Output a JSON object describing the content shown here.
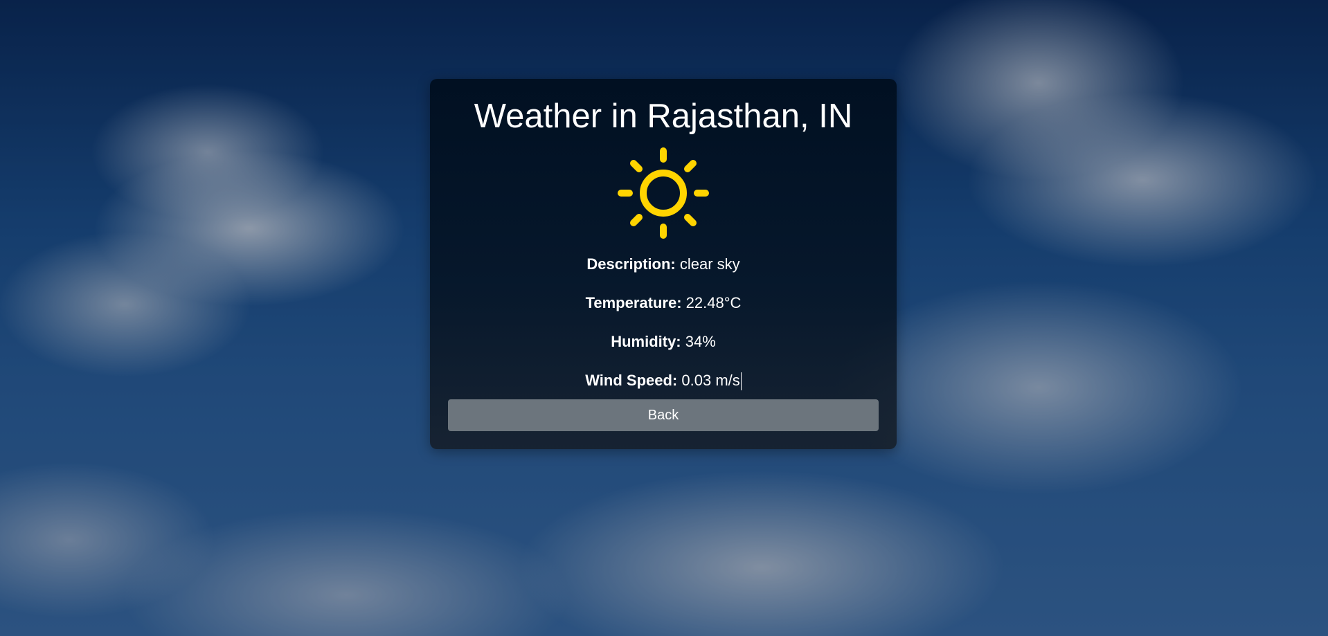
{
  "weather": {
    "title": "Weather in Rajasthan, IN",
    "icon": "sun-icon",
    "details": [
      {
        "label": "Description:",
        "value": "clear sky"
      },
      {
        "label": "Temperature:",
        "value": "22.48°C"
      },
      {
        "label": "Humidity:",
        "value": "34%"
      },
      {
        "label": "Wind Speed:",
        "value": "0.03 m/s"
      }
    ],
    "back_label": "Back"
  },
  "colors": {
    "sun": "#ffd400",
    "button": "#6c757d",
    "card": "#04121f"
  }
}
